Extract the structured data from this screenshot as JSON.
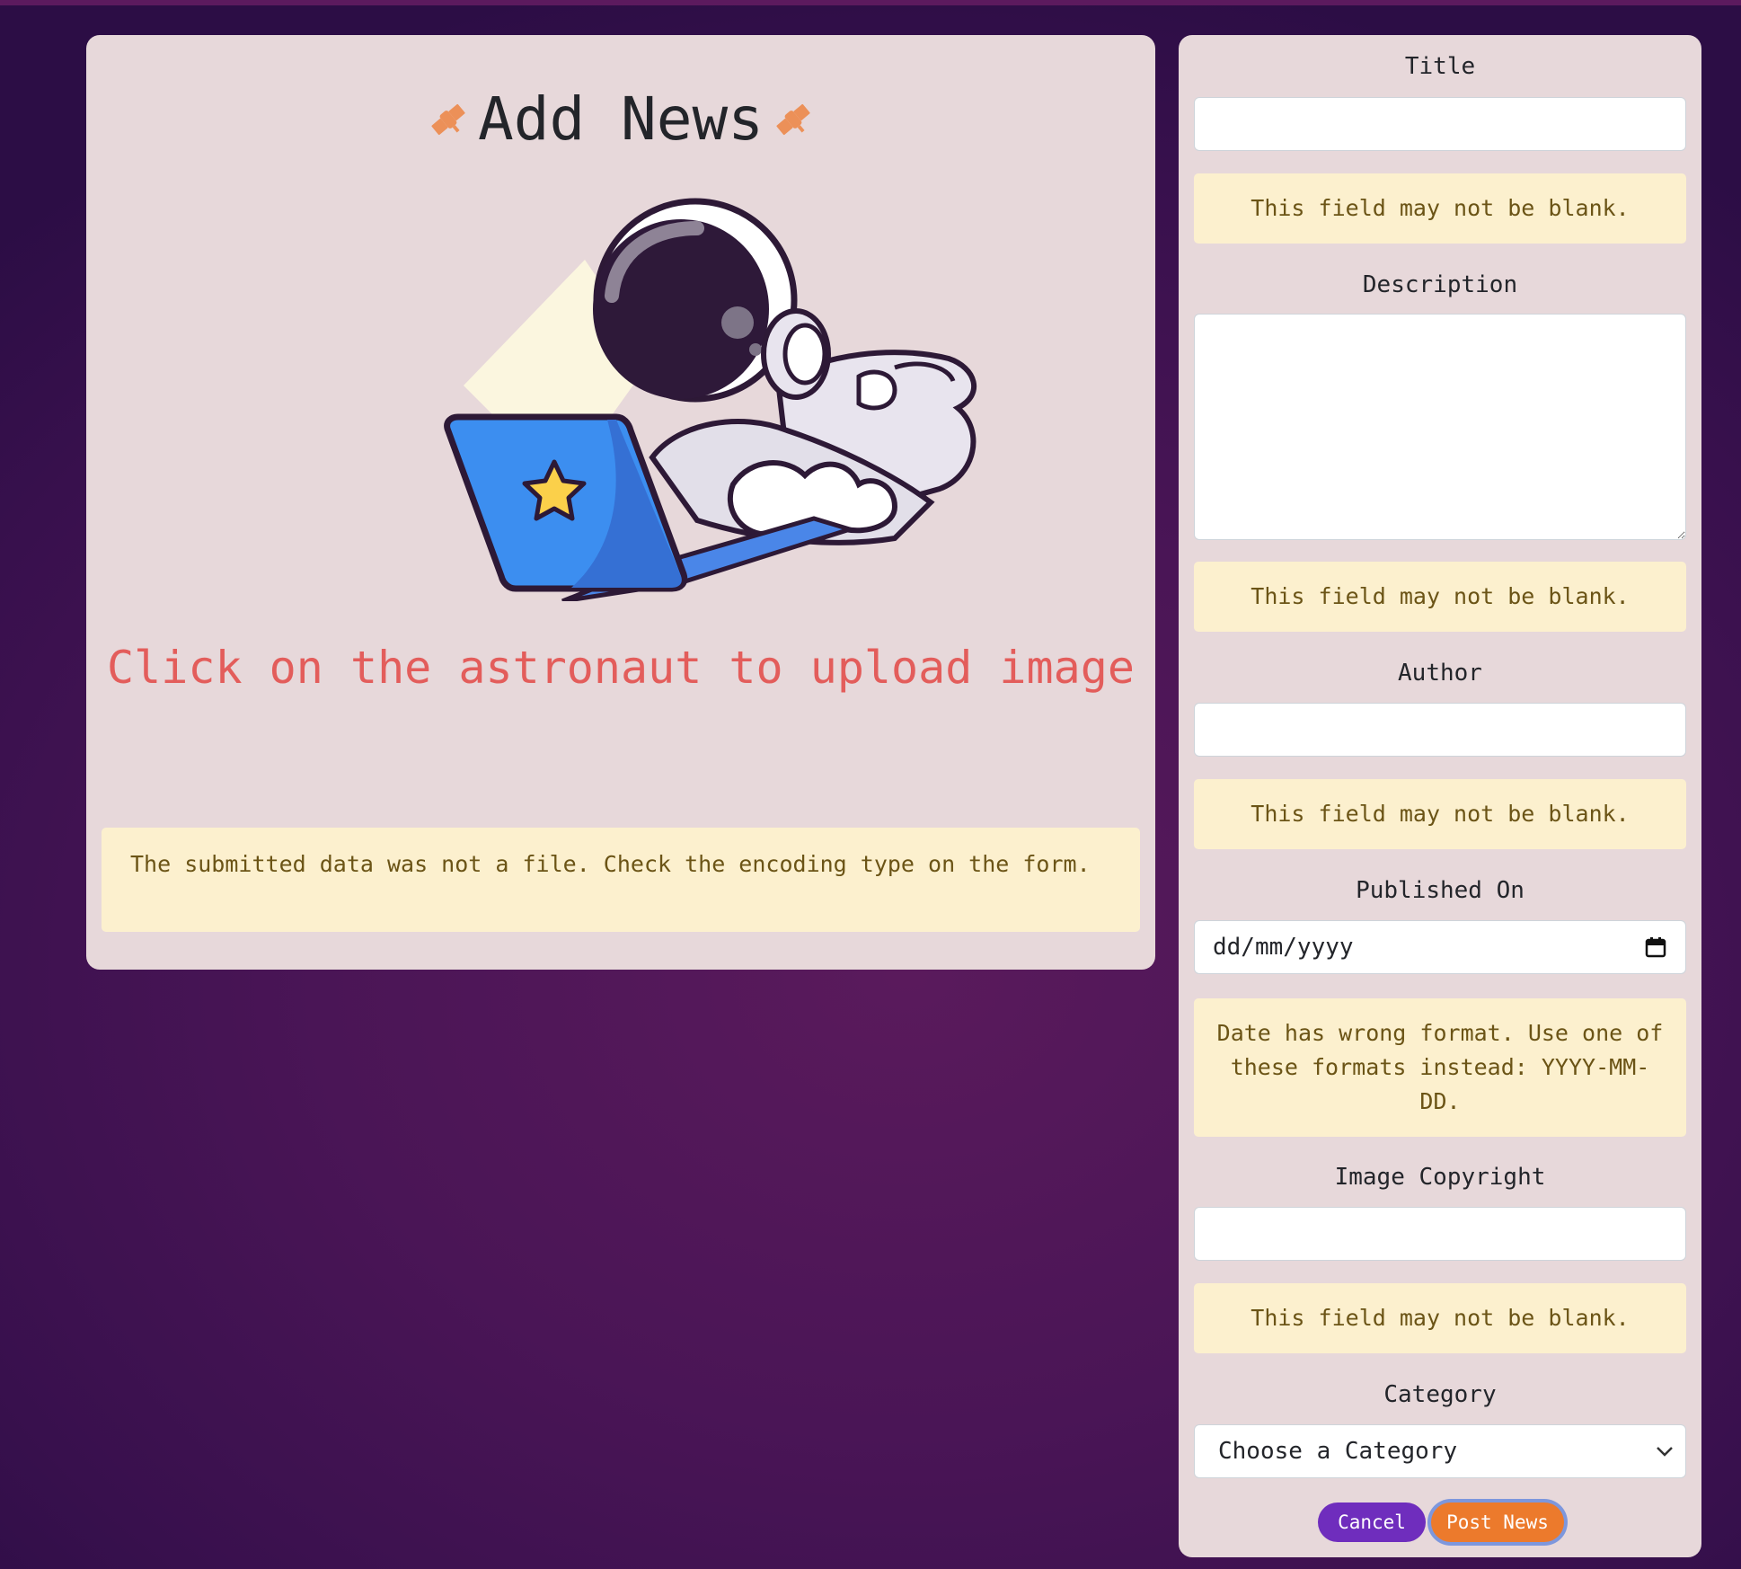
{
  "colors": {
    "background": "#4a1556",
    "card": "#e7d8da",
    "alert_bg": "#fcf0ce",
    "alert_text": "#6b5416",
    "hint_text": "#e35d5b",
    "cancel_button": "#6f2dbd",
    "post_button": "#ec7a2c"
  },
  "left_panel": {
    "title": "Add News",
    "title_icon": "satellite-icon",
    "illustration": "astronaut-with-laptop",
    "upload_hint": "Click on the astronaut to upload image",
    "image_error": "The submitted data was not a file. Check the encoding type on the form."
  },
  "form": {
    "title": {
      "label": "Title",
      "value": "",
      "error": "This field may not be blank."
    },
    "description": {
      "label": "Description",
      "value": "",
      "error": "This field may not be blank."
    },
    "author": {
      "label": "Author",
      "value": "",
      "error": "This field may not be blank."
    },
    "published_on": {
      "label": "Published On",
      "placeholder": "dd/mm/yyyy",
      "error": "Date has wrong format. Use one of these formats instead: YYYY-MM-DD."
    },
    "image_copyright": {
      "label": "Image Copyright",
      "value": "",
      "error": "This field may not be blank."
    },
    "category": {
      "label": "Category",
      "selected": "Choose a Category"
    },
    "cancel_label": "Cancel",
    "submit_label": "Post News"
  }
}
